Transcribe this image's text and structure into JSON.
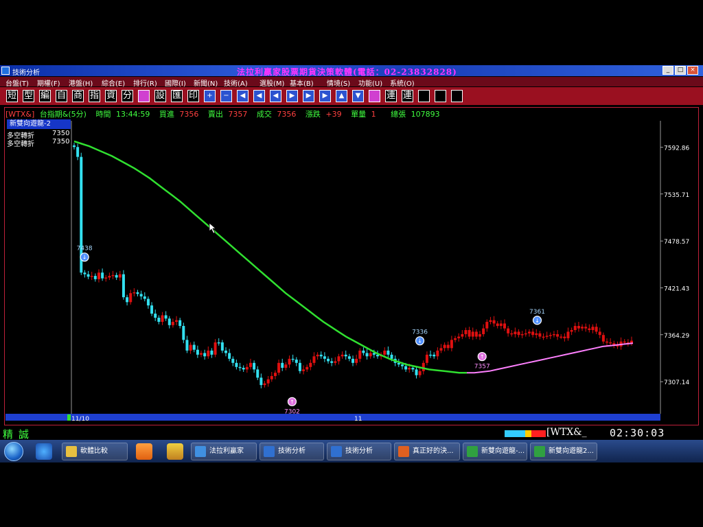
{
  "window": {
    "title": "技術分析",
    "app_title": "法拉利贏家股票期貨決策軟體(電話：02-23832828)",
    "controls": [
      "_",
      "□",
      "×"
    ]
  },
  "menu": [
    "台盤(T)",
    "期權(F)",
    "港盤(H)",
    "綜合(E)",
    "排行(R)",
    "國際(I)",
    "新聞(N)",
    "技術(A)",
    "選股(M)",
    "基本(B)",
    "情境(S)",
    "功能(U)",
    "系統(O)"
  ],
  "toolbar_chars": [
    "短",
    "型",
    "編",
    "自",
    "商",
    "指",
    "資",
    "分"
  ],
  "toolbar_chars2": [
    "設",
    "匯",
    "印"
  ],
  "toolbar_icons": [
    "+",
    "−",
    "◀",
    "◀",
    "◀",
    "▶",
    "▶",
    "▶",
    "▲",
    "▼"
  ],
  "toolbar_chars3": [
    "連",
    "連"
  ],
  "infobar": {
    "symbol": "[WTX&]",
    "name": "台指期&(5分)",
    "time_label": "時間",
    "time_value": "13:44:59",
    "bid_label": "買進",
    "bid_value": "7356",
    "ask_label": "賣出",
    "ask_value": "7357",
    "deal_label": "成交",
    "deal_value": "7356",
    "change_label": "漲跌",
    "change_value": "+39",
    "vol_label": "單量",
    "vol_value": "1",
    "total_label": "總張",
    "total_value": "107893"
  },
  "panel": {
    "title": "新雙向遊龍-2",
    "indicators": [
      {
        "label": "多空轉折",
        "value": "7350",
        "color": "#40ff40"
      },
      {
        "label": "多空轉折",
        "value": "7350",
        "color": "#ff66ff"
      }
    ]
  },
  "chart_data": {
    "type": "candlestick",
    "y_ticks": [
      7592.86,
      7535.71,
      7478.57,
      7421.43,
      7364.29,
      7307.14
    ],
    "ylim": [
      7268,
      7625
    ],
    "x_ticks": [
      "11/10",
      "11"
    ],
    "colors": {
      "down": "#33e0f0",
      "up": "#e01010",
      "ma_bear": "#30e030",
      "ma_bull": "#ff80ff"
    },
    "close": [
      7593,
      7581,
      7440,
      7438,
      7435,
      7436,
      7432,
      7440,
      7433,
      7434,
      7436,
      7437,
      7434,
      7438,
      7410,
      7404,
      7415,
      7416,
      7414,
      7411,
      7408,
      7400,
      7390,
      7385,
      7380,
      7388,
      7384,
      7376,
      7380,
      7382,
      7375,
      7358,
      7345,
      7352,
      7346,
      7340,
      7342,
      7338,
      7345,
      7340,
      7355,
      7355,
      7345,
      7342,
      7335,
      7330,
      7325,
      7324,
      7322,
      7325,
      7330,
      7322,
      7312,
      7303,
      7305,
      7310,
      7314,
      7318,
      7330,
      7324,
      7328,
      7335,
      7334,
      7330,
      7320,
      7322,
      7325,
      7330,
      7338,
      7340,
      7338,
      7335,
      7332,
      7330,
      7332,
      7338,
      7340,
      7338,
      7335,
      7330,
      7335,
      7345,
      7342,
      7338,
      7342,
      7340,
      7338,
      7340,
      7345,
      7340,
      7335,
      7330,
      7328,
      7326,
      7322,
      7324,
      7322,
      7315,
      7320,
      7330,
      7340,
      7340,
      7338,
      7345,
      7348,
      7352,
      7348,
      7358,
      7360,
      7362,
      7365,
      7370,
      7362,
      7368,
      7362,
      7365,
      7372,
      7380,
      7382,
      7378,
      7375,
      7378,
      7372,
      7366,
      7365,
      7368,
      7364,
      7365,
      7366,
      7368,
      7364,
      7366,
      7362,
      7362,
      7363,
      7364,
      7365,
      7362,
      7362,
      7360,
      7368,
      7370,
      7375,
      7372,
      7374,
      7372,
      7370,
      7374,
      7368,
      7364,
      7356,
      7355,
      7354,
      7352,
      7350,
      7356,
      7355,
      7354,
      7357
    ],
    "ma": [
      7600,
      7597,
      7594,
      7590,
      7586,
      7582,
      7577,
      7572,
      7567,
      7561,
      7555,
      7548,
      7541,
      7534,
      7527,
      7519,
      7511,
      7503,
      7495,
      7487,
      7479,
      7471,
      7463,
      7455,
      7447,
      7439,
      7431,
      7423,
      7415,
      7408,
      7401,
      7394,
      7387,
      7380,
      7374,
      7368,
      7362,
      7357,
      7352,
      7347,
      7342,
      7338,
      7334,
      7331,
      7328,
      7326,
      7324,
      7322,
      7321,
      7320,
      7319,
      7318,
      7318,
      7318,
      7319,
      7320,
      7322,
      7324,
      7326,
      7328,
      7330,
      7332,
      7334,
      7336,
      7338,
      7340,
      7342,
      7344,
      7346,
      7348,
      7350,
      7351,
      7352,
      7353,
      7354
    ],
    "ma_regime_switch": 0.82,
    "markers": [
      {
        "label": "7438",
        "value": 7438,
        "kind": "sell",
        "at": 0.01
      },
      {
        "label": "7302",
        "value": 7302,
        "kind": "buy",
        "at": 0.39
      },
      {
        "label": "7336",
        "value": 7336,
        "kind": "sell",
        "at": 0.61
      },
      {
        "label": "7357",
        "value": 7357,
        "kind": "buy",
        "at": 0.73
      },
      {
        "label": "7361",
        "value": 7361,
        "kind": "sell",
        "at": 0.82
      }
    ]
  },
  "status": {
    "left_text": "精誠",
    "symbol": "[WTX&_",
    "time": "02:30:03"
  },
  "taskbar": {
    "items": [
      {
        "label": "軟體比較",
        "color": "#e8c040"
      },
      {
        "label": "法拉利贏家",
        "color": "#4090e0"
      },
      {
        "label": "技術分析",
        "color": "#3070d0"
      },
      {
        "label": "技術分析",
        "color": "#3070d0"
      },
      {
        "label": "真正好的決...",
        "color": "#e06020"
      },
      {
        "label": "新雙向遊龍-...",
        "color": "#30a040"
      },
      {
        "label": "新雙向遊龍2...",
        "color": "#30a040"
      }
    ]
  }
}
